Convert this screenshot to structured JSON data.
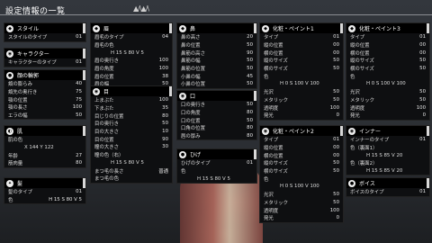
{
  "header": {
    "title": "設定情報の一覧",
    "deco": "▲/\\▲/\\"
  },
  "col1": [
    {
      "title": "スタイル",
      "rows": [
        [
          "スタイルのタイプ",
          "01"
        ]
      ]
    },
    {
      "title": "キャラクター",
      "rows": [
        [
          "キャラクターのタイプ",
          "01"
        ]
      ]
    },
    {
      "title": "顔の輪郭",
      "rows": [
        [
          "頬の膨らみ",
          "40"
        ],
        [
          "頬先の奥行き",
          "75"
        ],
        [
          "顎の位置",
          "75"
        ],
        [
          "顎の長さ",
          "100"
        ],
        [
          "エラの幅",
          "50"
        ]
      ]
    },
    {
      "title": "肌",
      "rows": [
        [
          "肌の色",
          ""
        ],
        [
          "X 144   Y 122",
          ""
        ],
        [
          "年齢",
          "27"
        ],
        [
          "筋肉量",
          "80"
        ]
      ]
    },
    {
      "title": "髪",
      "rows": [
        [
          "髪のタイプ",
          "01"
        ],
        [
          "色",
          "H 15    S 80    V 5"
        ]
      ]
    }
  ],
  "col2": [
    {
      "title": "眉",
      "rows": [
        [
          "眉毛のタイプ",
          "04"
        ],
        [
          "眉毛の色",
          ""
        ],
        [
          "H 15    S 80    V 5",
          ""
        ],
        [
          "眉の奥行き",
          "100"
        ],
        [
          "眉の角度",
          "100"
        ],
        [
          "眉の位置",
          "38"
        ],
        [
          "眉の幅",
          "50"
        ]
      ]
    },
    {
      "title": "目",
      "rows": [
        [
          "上まぶた",
          "100"
        ],
        [
          "下まぶた",
          "35"
        ],
        [
          "目じりの位置",
          "80"
        ],
        [
          "目の奥行き",
          "50"
        ],
        [
          "目の大きさ",
          "10"
        ],
        [
          "目の位置",
          "90"
        ],
        [
          "瞳の大きさ",
          "30"
        ],
        [
          "瞳の色（右）",
          ""
        ],
        [
          "H 15    S 80    V 5",
          ""
        ],
        [
          "まつ毛の長さ",
          "普通"
        ],
        [
          "まつ毛の色",
          ""
        ]
      ]
    }
  ],
  "col3": [
    {
      "title": "鼻",
      "rows": [
        [
          "鼻の高さ",
          "20"
        ],
        [
          "鼻の位置",
          "50"
        ],
        [
          "鼻筋の高さ",
          "90"
        ],
        [
          "鼻筋の幅",
          "50"
        ],
        [
          "鼻筋の位置",
          "50"
        ],
        [
          "小鼻の幅",
          "45"
        ],
        [
          "小鼻の位置",
          "50"
        ]
      ]
    },
    {
      "title": "口",
      "rows": [
        [
          "口の奥行き",
          "50"
        ],
        [
          "口の角度",
          "80"
        ],
        [
          "口の位置",
          "50"
        ],
        [
          "口角の位置",
          "80"
        ],
        [
          "唇の厚み",
          "80"
        ]
      ]
    },
    {
      "title": "ひげ",
      "rows": [
        [
          "ひげのタイプ",
          "01"
        ],
        [
          "色",
          ""
        ],
        [
          "H 15    S 80    V 5",
          ""
        ]
      ]
    }
  ],
  "col4": [
    {
      "title": "化粧・ペイント1",
      "rows": [
        [
          "タイプ",
          "01"
        ],
        [
          "縦の位置",
          "00"
        ],
        [
          "横の位置",
          "00"
        ],
        [
          "縦のサイズ",
          "50"
        ],
        [
          "横のサイズ",
          "50"
        ],
        [
          "色",
          ""
        ],
        [
          "H 0    S 100    V 100",
          ""
        ],
        [
          "光沢",
          "50"
        ],
        [
          "メタリック",
          "50"
        ],
        [
          "透明度",
          "100"
        ],
        [
          "発光",
          "0"
        ]
      ]
    },
    {
      "title": "化粧・ペイント2",
      "rows": [
        [
          "タイプ",
          "01"
        ],
        [
          "縦の位置",
          "00"
        ],
        [
          "横の位置",
          "00"
        ],
        [
          "縦のサイズ",
          "50"
        ],
        [
          "横のサイズ",
          "50"
        ],
        [
          "色",
          ""
        ],
        [
          "H 0    S 100    V 100",
          ""
        ],
        [
          "光沢",
          "50"
        ],
        [
          "メタリック",
          "50"
        ],
        [
          "透明度",
          "100"
        ],
        [
          "発光",
          "0"
        ]
      ]
    }
  ],
  "col5": [
    {
      "title": "化粧・ペイント3",
      "rows": [
        [
          "タイプ",
          "01"
        ],
        [
          "縦の位置",
          "00"
        ],
        [
          "横の位置",
          "00"
        ],
        [
          "縦のサイズ",
          "50"
        ],
        [
          "横のサイズ",
          "50"
        ],
        [
          "色",
          ""
        ],
        [
          "H 0    S 100    V 100",
          ""
        ],
        [
          "光沢",
          "50"
        ],
        [
          "メタリック",
          "50"
        ],
        [
          "透明度",
          "100"
        ],
        [
          "発光",
          "0"
        ]
      ]
    },
    {
      "title": "インナー",
      "rows": [
        [
          "インナーのタイプ",
          "01"
        ],
        [
          "色（裏面1）",
          ""
        ],
        [
          "H 15    S 85    V 20",
          ""
        ],
        [
          "色（裏面2）",
          ""
        ],
        [
          "H 15    S 85    V 20",
          ""
        ]
      ]
    },
    {
      "title": "ボイス",
      "rows": [
        [
          "ボイスのタイプ",
          "01"
        ]
      ]
    }
  ]
}
